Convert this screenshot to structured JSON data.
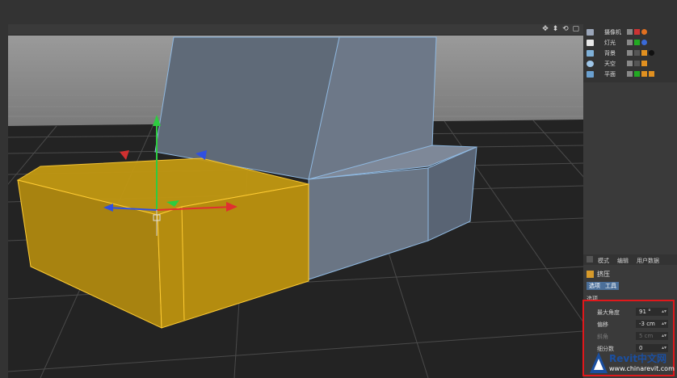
{
  "viewport": {
    "nav_icons": "✥ ⬍ ⟲ ▢"
  },
  "objects": [
    {
      "label": "摄像机",
      "icon": "camera-icon",
      "color": "#9aa5b8"
    },
    {
      "label": "灯光",
      "icon": "light-icon",
      "color": "#e8e8e8"
    },
    {
      "label": "背景",
      "icon": "background-icon",
      "color": "#7fb0d8"
    },
    {
      "label": "天空",
      "icon": "sky-icon",
      "color": "#9fc6e8"
    },
    {
      "label": "平面",
      "icon": "plane-icon",
      "color": "#6aa0d0"
    }
  ],
  "attributes": {
    "tabs": [
      "模式",
      "编辑",
      "用户数据"
    ],
    "object_name": "挤压",
    "buttons": [
      "选项",
      "工具"
    ],
    "section": "选项",
    "properties": [
      {
        "label": "最大角度",
        "value": "91 °",
        "enabled": true
      },
      {
        "label": "偏移",
        "value": "-3 cm",
        "enabled": true
      },
      {
        "label": "斜角",
        "value": "5 cm",
        "enabled": false
      },
      {
        "label": "细分数",
        "value": "0",
        "enabled": true
      }
    ]
  },
  "watermark": {
    "title": "Revit中文网",
    "subtitle": "www.chinarevit.com"
  },
  "colors": {
    "selection": "#d9a400",
    "highlight_box": "#e0181b",
    "axis_y": "#2ecc40",
    "axis_x": "#e03030",
    "axis_z": "#3050e0"
  }
}
